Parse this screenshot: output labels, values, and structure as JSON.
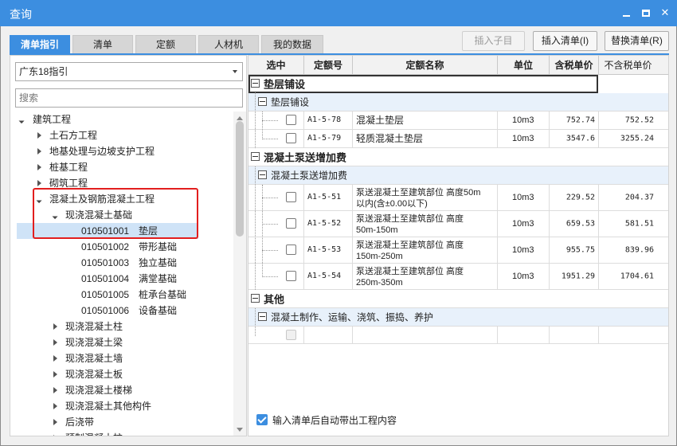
{
  "window": {
    "title": "查询"
  },
  "tabs": [
    {
      "label": "清单指引",
      "active": true
    },
    {
      "label": "清单"
    },
    {
      "label": "定额"
    },
    {
      "label": "人材机"
    },
    {
      "label": "我的数据"
    }
  ],
  "toolbar": {
    "insert_child": "插入子目",
    "insert_list": "插入清单(I)",
    "replace_list": "替换清单(R)"
  },
  "left": {
    "select_value": "广东18指引",
    "search_placeholder": "搜索",
    "tree": [
      {
        "label": "建筑工程",
        "state": "expanded"
      },
      {
        "label": "土石方工程",
        "state": "collapsed"
      },
      {
        "label": "地基处理与边坡支护工程",
        "state": "collapsed"
      },
      {
        "label": "桩基工程",
        "state": "collapsed"
      },
      {
        "label": "砌筑工程",
        "state": "collapsed"
      },
      {
        "label": "混凝土及钢筋混凝土工程",
        "state": "expanded"
      },
      {
        "label": "现浇混凝土基础",
        "state": "expanded"
      },
      {
        "code": "010501001",
        "name": "垫层",
        "selected": true
      },
      {
        "code": "010501002",
        "name": "带形基础"
      },
      {
        "code": "010501003",
        "name": "独立基础"
      },
      {
        "code": "010501004",
        "name": "满堂基础"
      },
      {
        "code": "010501005",
        "name": "桩承台基础"
      },
      {
        "code": "010501006",
        "name": "设备基础"
      },
      {
        "label": "现浇混凝土柱",
        "state": "collapsed"
      },
      {
        "label": "现浇混凝土梁",
        "state": "collapsed"
      },
      {
        "label": "现浇混凝土墙",
        "state": "collapsed"
      },
      {
        "label": "现浇混凝土板",
        "state": "collapsed"
      },
      {
        "label": "现浇混凝土楼梯",
        "state": "collapsed"
      },
      {
        "label": "现浇混凝土其他构件",
        "state": "collapsed"
      },
      {
        "label": "后浇带",
        "state": "collapsed"
      },
      {
        "label": "预制混凝土柱",
        "state": "collapsed"
      }
    ]
  },
  "grid": {
    "columns": [
      "选中",
      "定额号",
      "定额名称",
      "单位",
      "含税单价",
      "不含税单价"
    ],
    "groups": [
      {
        "title": "垫层铺设",
        "sub": "垫层铺设",
        "rows": [
          {
            "code": "A1-5-78",
            "name": "混凝土垫层",
            "unit": "10m3",
            "price_tax": "752.74",
            "price_notax": "752.52"
          },
          {
            "code": "A1-5-79",
            "name": "轻质混凝土垫层",
            "unit": "10m3",
            "price_tax": "3547.6",
            "price_notax": "3255.24"
          }
        ]
      },
      {
        "title": "混凝土泵送增加费",
        "sub": "混凝土泵送增加费",
        "rows": [
          {
            "code": "A1-5-51",
            "name1": "泵送混凝土至建筑部位 高度50m",
            "name2": "以内(含±0.00以下)",
            "unit": "10m3",
            "price_tax": "229.52",
            "price_notax": "204.37"
          },
          {
            "code": "A1-5-52",
            "name1": "泵送混凝土至建筑部位 高度",
            "name2": "50m-150m",
            "unit": "10m3",
            "price_tax": "659.53",
            "price_notax": "581.51"
          },
          {
            "code": "A1-5-53",
            "name1": "泵送混凝土至建筑部位 高度",
            "name2": "150m-250m",
            "unit": "10m3",
            "price_tax": "955.75",
            "price_notax": "839.96"
          },
          {
            "code": "A1-5-54",
            "name1": "泵送混凝土至建筑部位 高度",
            "name2": "250m-350m",
            "unit": "10m3",
            "price_tax": "1951.29",
            "price_notax": "1704.61"
          }
        ]
      },
      {
        "title": "其他",
        "sub": "混凝土制作、运输、浇筑、振捣、养护"
      }
    ]
  },
  "footer": {
    "auto_check_label": "输入清单后自动带出工程内容",
    "auto_checked": true
  }
}
